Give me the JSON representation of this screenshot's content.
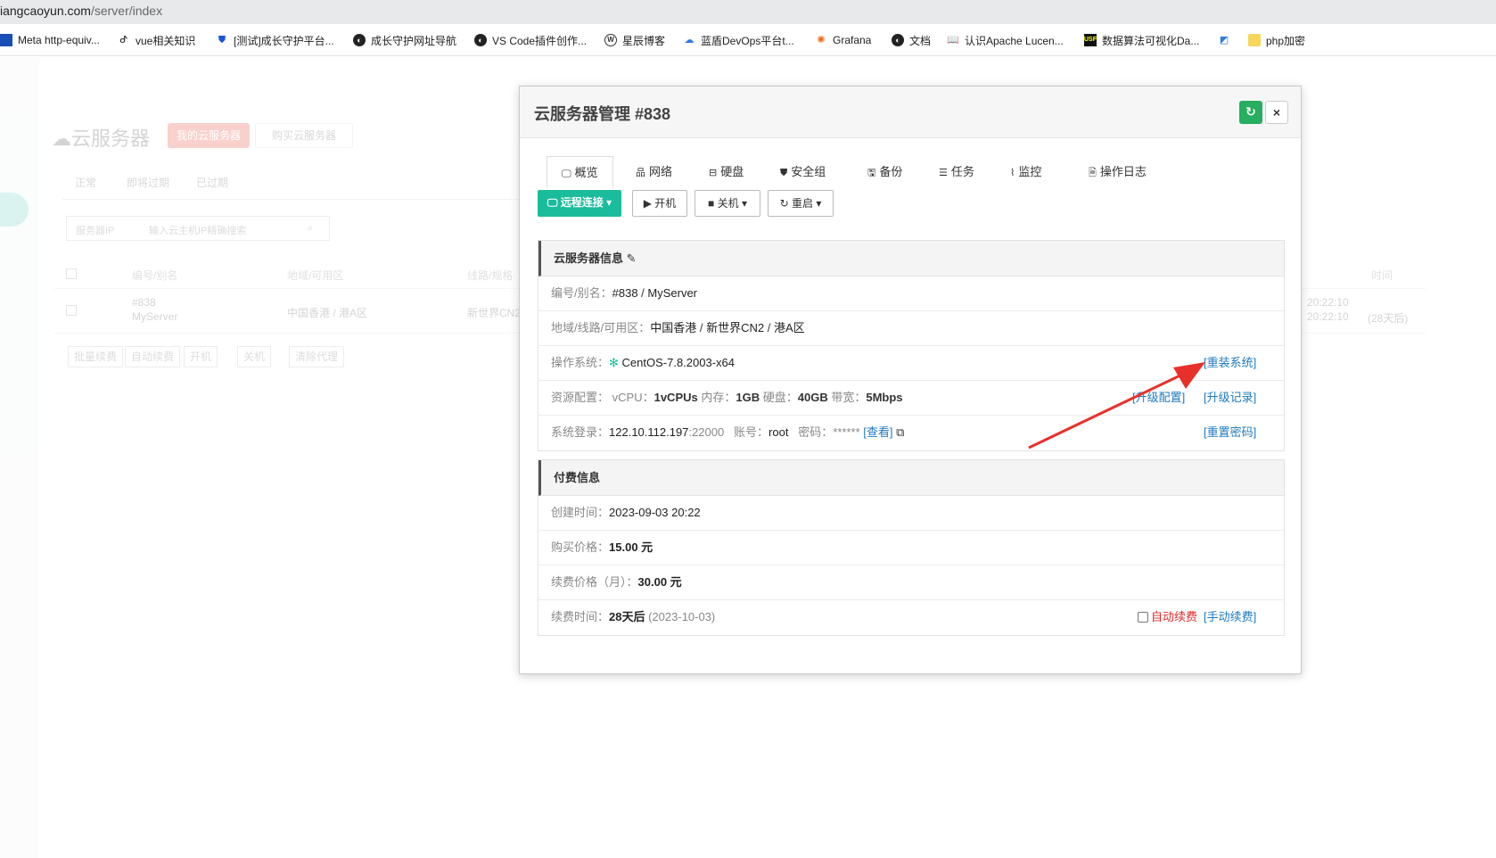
{
  "browser": {
    "url_host": "iangcaoyun.com",
    "url_path": "/server/index",
    "bookmarks": [
      {
        "label": "Meta http-equiv...",
        "icon": "page-icon"
      },
      {
        "label": "vue相关知识",
        "icon": "vue-icon"
      },
      {
        "label": "[测试]成长守护平台...",
        "icon": "shield-icon"
      },
      {
        "label": "成长守护网址导航",
        "icon": "globe-icon"
      },
      {
        "label": "VS Code插件创作...",
        "icon": "globe-icon"
      },
      {
        "label": "星辰博客",
        "icon": "wordpress-icon"
      },
      {
        "label": "蓝盾DevOps平台t...",
        "icon": "cloud-icon"
      },
      {
        "label": "Grafana",
        "icon": "grafana-icon"
      },
      {
        "label": "文档",
        "icon": "globe-icon"
      },
      {
        "label": "认识Apache Lucen...",
        "icon": "book-icon"
      },
      {
        "label": "数据算法可视化Da...",
        "icon": "usfca-icon"
      },
      {
        "label": "",
        "icon": "bookmark-icon"
      },
      {
        "label": "php加密",
        "icon": "folder-icon"
      }
    ]
  },
  "background": {
    "title": "云服务器",
    "my_servers": "我的云服务器",
    "buy_server": "购买云服务器",
    "tabs": [
      "正常",
      "即将过期",
      "已过期"
    ],
    "search_type": "服务器IP",
    "search_placeholder": "输入云主机IP精确搜索",
    "columns": [
      "编号/别名",
      "地域/可用区",
      "线路/规格",
      "时间"
    ],
    "row": {
      "id": "#838",
      "alias": "MyServer",
      "region": "中国香港 / 港A区",
      "line": "新世界CN2",
      "time1": "20:22:10",
      "time2": "20:22:10",
      "remain": "(28天后)"
    },
    "bulk_actions": [
      "批量续费",
      "自动续费",
      "开机",
      "关机",
      "清除代理"
    ]
  },
  "modal": {
    "title": "云服务器管理 #838",
    "tabs": [
      "概览",
      "网络",
      "硬盘",
      "安全组",
      "备份",
      "任务",
      "监控",
      "操作日志"
    ],
    "actions": {
      "remote": "远程连接",
      "power_on": "开机",
      "power_off": "关机",
      "restart": "重启"
    },
    "server_info": {
      "heading": "云服务器信息",
      "id_label": "编号/别名：",
      "id_value": "#838",
      "alias": "MyServer",
      "region_label": "地域/线路/可用区：",
      "region": "中国香港",
      "line": "新世界CN2",
      "zone": "港A区",
      "os_label": "操作系统：",
      "os_value": "CentOS-7.8.2003-x64",
      "reinstall": "[重装系统]",
      "res_label": "资源配置：",
      "vcpu_label": "vCPU：",
      "vcpu": "1vCPUs",
      "mem_label": "内存：",
      "mem": "1GB",
      "disk_label": "硬盘：",
      "disk": "40GB",
      "bw_label": "带宽：",
      "bw": "5Mbps",
      "upgrade": "[升级配置]",
      "upgrade_log": "[升级记录]",
      "login_label": "系统登录：",
      "ip": "122.10.112.197",
      "port": ":22000",
      "account_label": "账号：",
      "account": "root",
      "pwd_label": "密码：",
      "pwd": "******",
      "view": "[查看]",
      "reset_pwd": "[重置密码]"
    },
    "billing": {
      "heading": "付费信息",
      "created_label": "创建时间：",
      "created": "2023-09-03 20:22",
      "price_label": "购买价格：",
      "price": "15.00 元",
      "renew_label": "续费价格（月）：",
      "renew": "30.00 元",
      "expire_label": "续费时间：",
      "expire": "28天后",
      "expire_date": "(2023-10-03)",
      "auto_renew": "自动续费",
      "manual_renew": "[手动续费]"
    }
  },
  "colors": {
    "primary": "#1abc9c",
    "refresh": "#27ae60",
    "link": "#1f7bc1",
    "danger": "#e02a2a",
    "annotation_arrow": "#e8302a"
  }
}
